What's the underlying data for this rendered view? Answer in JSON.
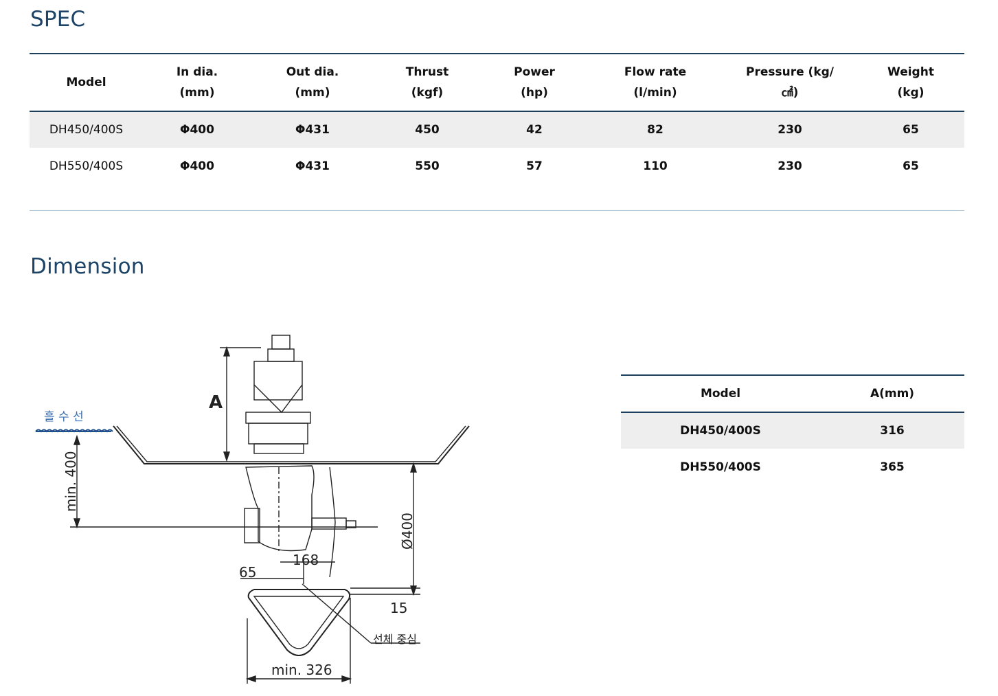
{
  "spec": {
    "title": "SPEC",
    "headers": [
      [
        "Model"
      ],
      [
        "In dia.",
        "(mm)"
      ],
      [
        "Out dia.",
        "(mm)"
      ],
      [
        "Thrust",
        "(kgf)"
      ],
      [
        "Power",
        "(hp)"
      ],
      [
        "Flow rate",
        "(l/min)"
      ],
      [
        "Pressure (kg/",
        "㎠)"
      ],
      [
        "Weight",
        "(kg)"
      ]
    ],
    "rows": [
      [
        "DH450/400S",
        "Φ400",
        "Φ431",
        "450",
        "42",
        "82",
        "230",
        "65"
      ],
      [
        "DH550/400S",
        "Φ400",
        "Φ431",
        "550",
        "57",
        "110",
        "230",
        "65"
      ]
    ]
  },
  "dimension": {
    "title": "Dimension",
    "table": {
      "headers": [
        "Model",
        "A(mm)"
      ],
      "rows": [
        [
          "DH450/400S",
          "316"
        ],
        [
          "DH550/400S",
          "365"
        ]
      ]
    },
    "drawing_labels": {
      "a": "A",
      "waterline": "흘 수 선",
      "min400": "min. 400",
      "d400": "Ø400",
      "d168": "168",
      "d65": "65",
      "d15": "15",
      "center": "선체 중심",
      "min326": "min. 326"
    }
  }
}
